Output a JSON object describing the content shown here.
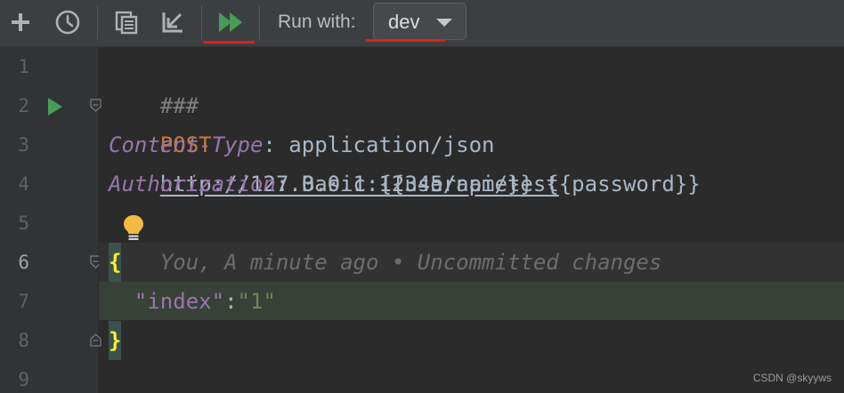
{
  "toolbar": {
    "buttons": [
      {
        "name": "add-request-button",
        "icon": "plus-icon"
      },
      {
        "name": "history-button",
        "icon": "clock-icon"
      },
      {
        "name": "copy-request-button",
        "icon": "copy-icon"
      },
      {
        "name": "import-button",
        "icon": "import-arrow-icon"
      },
      {
        "name": "run-all-button",
        "icon": "run-all-icon"
      }
    ],
    "run_with_label": "Run with:",
    "environment": {
      "selected": "dev",
      "icon": "chevron-down-icon"
    }
  },
  "editor": {
    "line_numbers": [
      "1",
      "2",
      "3",
      "4",
      "5",
      "6",
      "7",
      "8",
      "9"
    ],
    "current_line": "6",
    "lines": {
      "l1": {
        "comment": "###"
      },
      "l2": {
        "method": "POST",
        "url": "http://127.0.0.1:12345/api/test"
      },
      "l3": {
        "header": "Content-Type",
        "sep": ": ",
        "value": "application/json"
      },
      "l4": {
        "header": "Authorization",
        "sep": ": ",
        "value": "Basic {{username}} {{password}}"
      },
      "l6": {
        "brace": "{",
        "inlay": "You, A minute ago • Uncommitted changes"
      },
      "l7": {
        "key": "\"index\"",
        "colon": ":",
        "value": "\"1\""
      },
      "l8": {
        "brace": "}"
      }
    },
    "gutter_icons": {
      "run": "run-request-icon",
      "bulb": "lightbulb-icon",
      "fold": "fold-icon"
    }
  },
  "watermark": "CSDN @skyyws",
  "colors": {
    "background": "#2b2b2b",
    "toolbar": "#3c3f41",
    "run_green": "#499c54",
    "annotation_red": "#e0201c",
    "bulb_yellow": "#f4b942"
  }
}
